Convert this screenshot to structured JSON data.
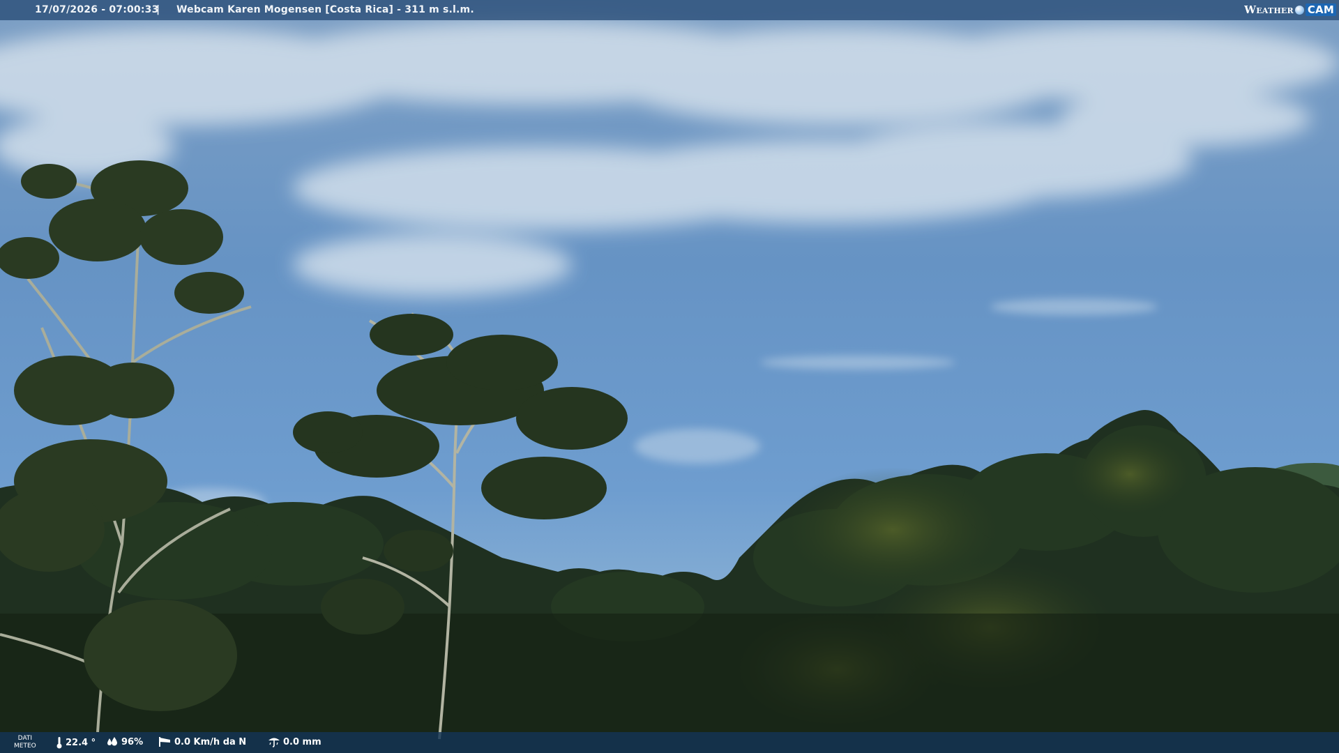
{
  "header": {
    "timestamp": "17/07/2026 - 07:00:33",
    "separator": "|",
    "title": "Webcam Karen Mogensen [Costa Rica] - 311 m s.l.m."
  },
  "logo": {
    "weather": "Weather",
    "cam": "CAM"
  },
  "footer": {
    "dati_line1": "DATI",
    "dati_line2": "METEO",
    "temperature": "22.4 °",
    "humidity": "96%",
    "wind": "0.0 Km/h da N",
    "rain": "0.0 mm"
  },
  "icons": {
    "temperature": "thermometer-icon",
    "humidity": "drops-icon",
    "wind": "windsock-icon",
    "rain": "rain-gauge-icon"
  },
  "colors": {
    "sky_top": "#7c9ec2",
    "sky_mid": "#5d8dc1",
    "foliage": "#1d2c19",
    "bar": "#284c76"
  }
}
